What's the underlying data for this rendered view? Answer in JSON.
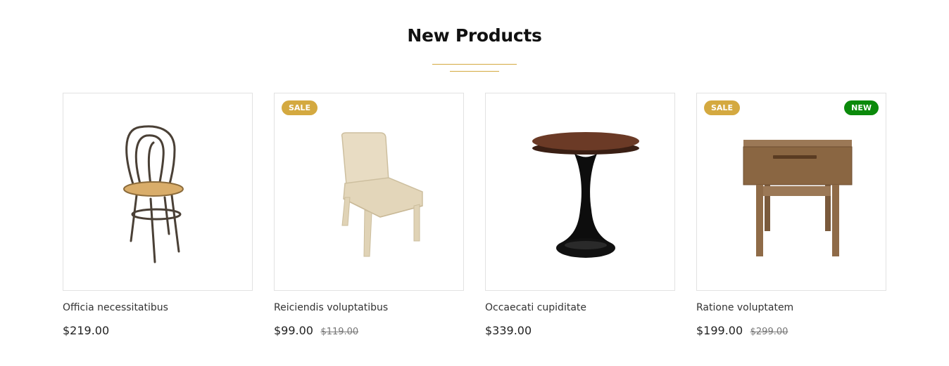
{
  "section": {
    "title": "New Products"
  },
  "products": [
    {
      "name": "Officia necessitatibus",
      "price": "$219.00",
      "old_price": "",
      "badges": []
    },
    {
      "name": "Reiciendis voluptatibus",
      "price": "$99.00",
      "old_price": "$119.00",
      "badges": [
        "SALE"
      ]
    },
    {
      "name": "Occaecati cupiditate",
      "price": "$339.00",
      "old_price": "",
      "badges": []
    },
    {
      "name": "Ratione voluptatem",
      "price": "$199.00",
      "old_price": "$299.00",
      "badges": [
        "SALE",
        "NEW"
      ]
    }
  ],
  "colors": {
    "accent": "#d4a940",
    "sale_badge": "#d4a940",
    "new_badge": "#0b8a0b"
  }
}
